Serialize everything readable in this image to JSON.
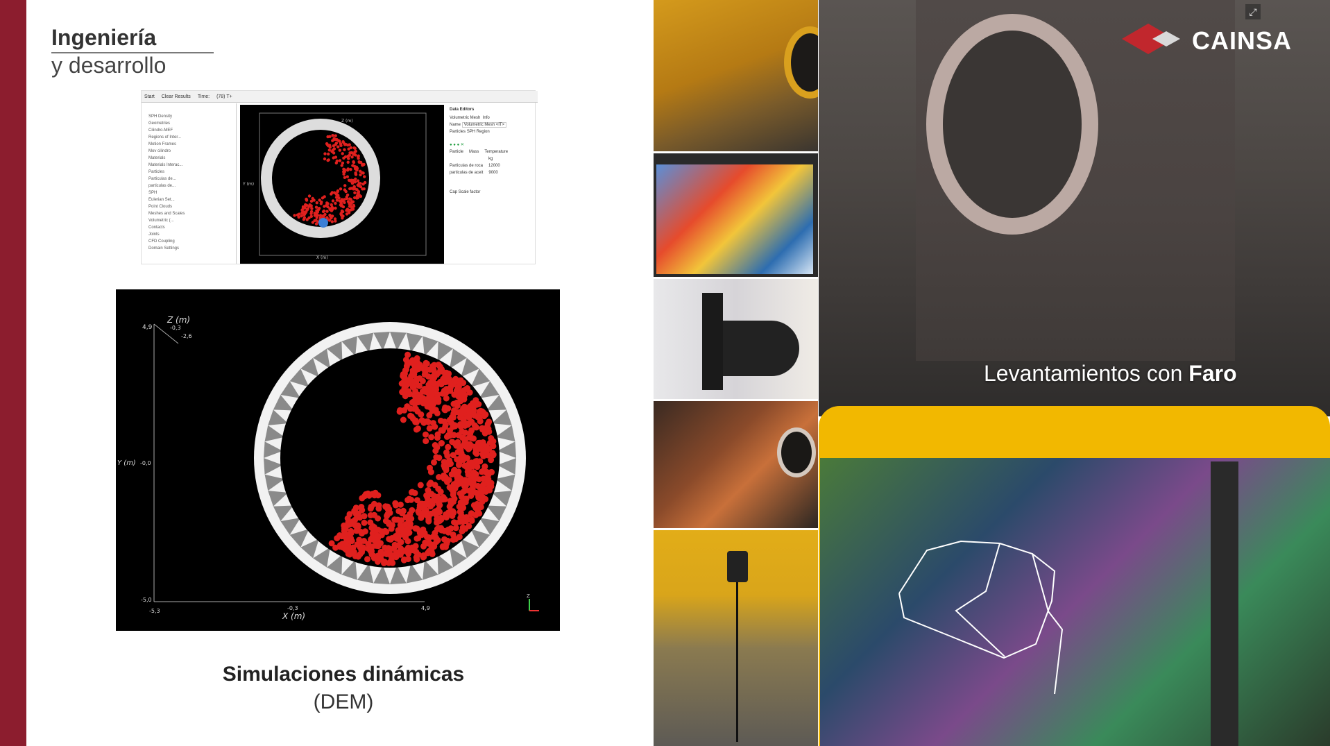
{
  "heading": {
    "strong": "Ingeniería",
    "sub": "y desarrollo"
  },
  "simulation_caption": {
    "strong": "Simulaciones dinámicas",
    "sub": "(DEM)"
  },
  "software": {
    "toolbar": [
      "Start",
      "Clear Results",
      "Time:",
      "(78) T+"
    ],
    "tree": [
      "SPH Density",
      "Geometries",
      "Cilindro-MEF",
      "Regions of Inter...",
      "Motion Frames",
      "Mov cilindro",
      "Materials",
      "Materials Interac...",
      "Particles",
      "Particulas de...",
      "particulas de...",
      "SPH",
      "Eulerian Set...",
      "Point Clouds",
      "Meshes and Scales",
      "Volumetric (...",
      "Contacts",
      "Joints",
      "CFD Coupling",
      "Domain Settings"
    ],
    "props": {
      "title": "Data Editors",
      "field1": "Volumetric Mesh",
      "field2": "Info",
      "name_label": "Name",
      "name_value": "Volumetric Mesh <IT>",
      "tabs": [
        "Particles",
        "SPH",
        "Region"
      ],
      "col1": "Particle",
      "col2": "Mass",
      "col3": "Temperature",
      "unit": "kg",
      "row1": "Particulas de roca",
      "row1_val": "12000",
      "row2": "particulas de aceit",
      "row2_val": "9000",
      "cap_label": "Cap Scale factor"
    },
    "axis": {
      "x": "X (m)",
      "y": "Y (m)",
      "z": "Z (m)"
    }
  },
  "dem": {
    "z_label": "Z (m)",
    "y_label": "Y (m)",
    "x_label": "X (m)",
    "y_top": "4,9",
    "y_mid": "-0,0",
    "y_bottom": "-5,0",
    "x_left": "-5,3",
    "x_mid": "-0,3",
    "x_right": "4,9",
    "z_a": "-0,3",
    "z_b": "-2,6",
    "axis_y": "Y",
    "axis_z": "Z"
  },
  "faro_caption": {
    "prefix": "Levantamientos con ",
    "brand": "Faro"
  },
  "logo": {
    "text": "CAINSA"
  },
  "colors": {
    "accent": "#8c1d2e",
    "particle": "#e0201e",
    "tablet": "#f2b800"
  },
  "icons": [
    "expand-icon",
    "cainsa-logo-icon"
  ]
}
